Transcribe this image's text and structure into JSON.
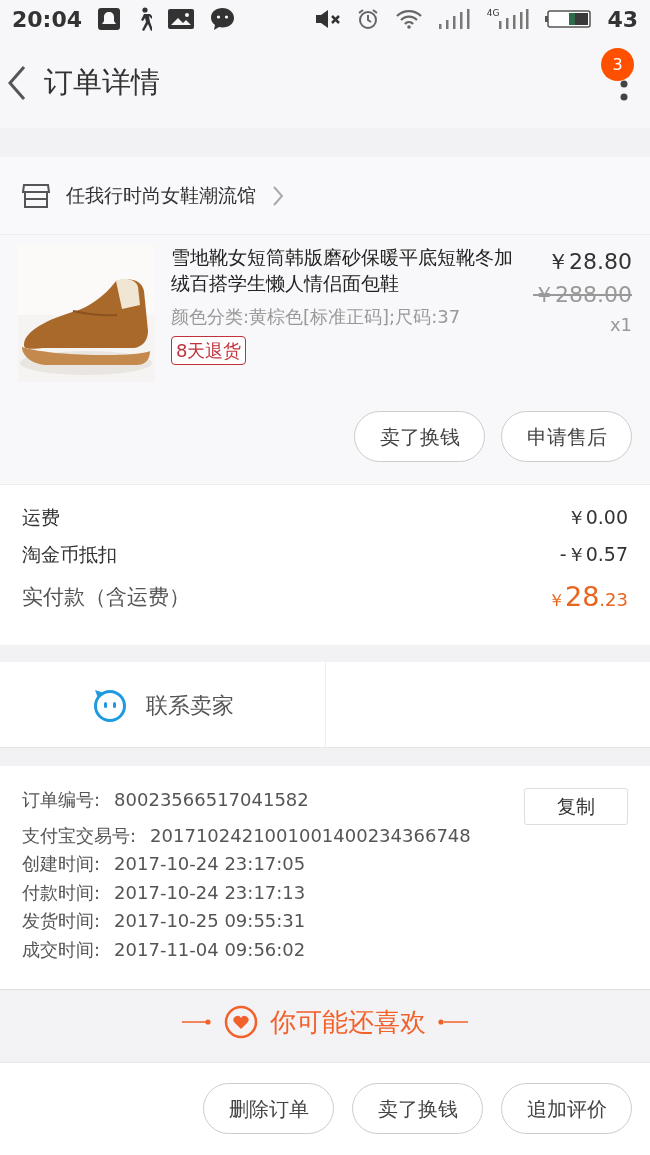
{
  "status_bar": {
    "time": "20:04",
    "network": "4G",
    "battery": "43"
  },
  "header": {
    "title": "订单详情",
    "badge": "3"
  },
  "shop": {
    "name": "任我行时尚女鞋潮流馆"
  },
  "product": {
    "kind": "picture",
    "title": "雪地靴女短筒韩版磨砂保暖平底短靴冬加绒百搭学生懒人情侣面包鞋",
    "sku": "颜色分类:黄棕色[标准正码];尺码:37",
    "price": "￥28.80",
    "original_price": "￥288.00",
    "quantity": "x1",
    "tag": "8天退货"
  },
  "product_actions": [
    "卖了换钱",
    "申请售后"
  ],
  "summary": {
    "rows": [
      {
        "label": "运费",
        "value": "￥0.00"
      },
      {
        "label": "淘金币抵扣",
        "value": "-￥0.57"
      }
    ],
    "total": {
      "label": "实付款（含运费）",
      "currency": "￥",
      "integer": "28",
      "decimal": ".23"
    }
  },
  "contact": {
    "label": "联系卖家"
  },
  "order_info": {
    "copy_button": "复制",
    "rows": [
      {
        "label": "订单编号:",
        "value": "80023566517041582"
      },
      {
        "label": "支付宝交易号:",
        "value": "2017102421001001400234366748"
      },
      {
        "label": "创建时间:",
        "value": "2017-10-24 23:17:05"
      },
      {
        "label": "付款时间:",
        "value": "2017-10-24 23:17:13"
      },
      {
        "label": "发货时间:",
        "value": "2017-10-25 09:55:31"
      },
      {
        "label": "成交时间:",
        "value": "2017-11-04 09:56:02"
      }
    ]
  },
  "recommend": {
    "title": "你可能还喜欢"
  },
  "bottom_actions": [
    "删除订单",
    "卖了换钱",
    "追加评价"
  ]
}
